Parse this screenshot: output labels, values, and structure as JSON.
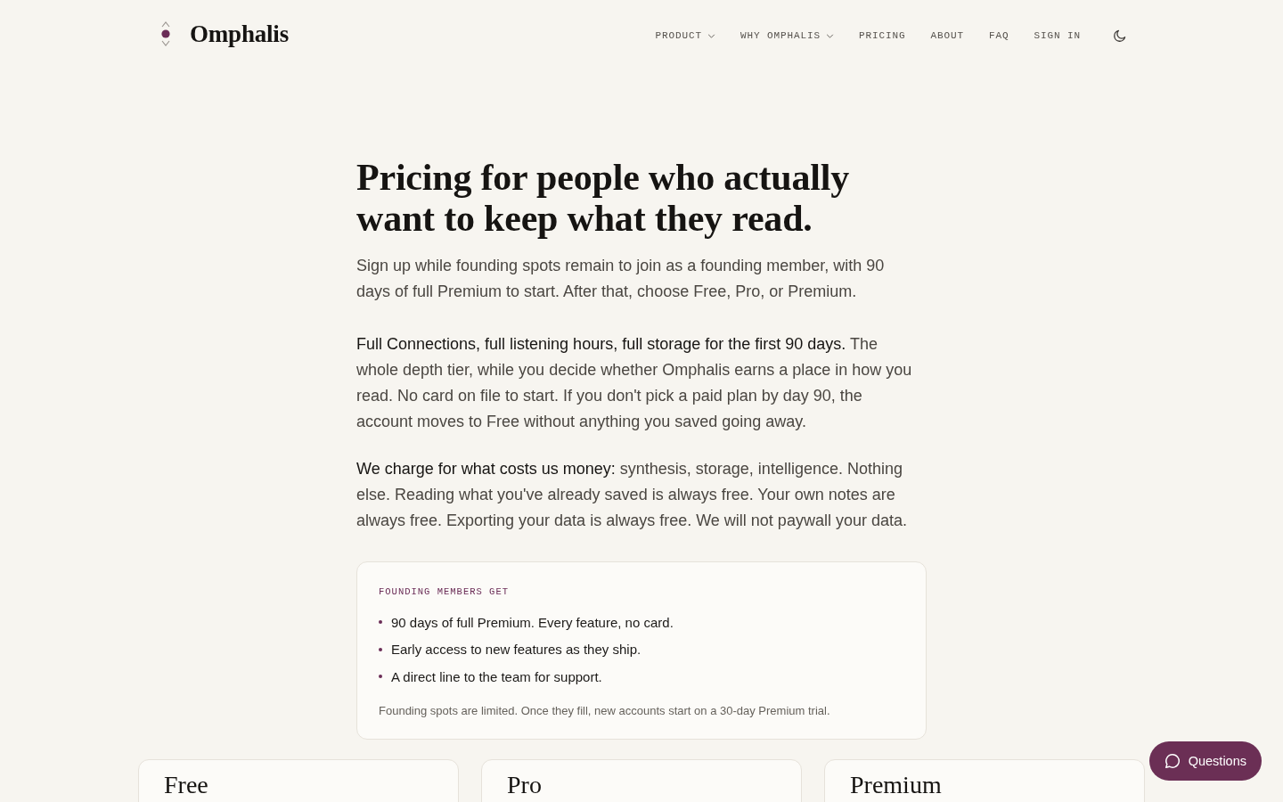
{
  "header": {
    "brand": "Omphalis",
    "nav": [
      {
        "label": "PRODUCT",
        "kind": "dropdown"
      },
      {
        "label": "WHY OMPHALIS",
        "kind": "dropdown"
      },
      {
        "label": "PRICING",
        "kind": "link"
      },
      {
        "label": "ABOUT",
        "kind": "link"
      },
      {
        "label": "FAQ",
        "kind": "link"
      },
      {
        "label": "SIGN IN",
        "kind": "link"
      }
    ]
  },
  "hero": {
    "title": "Pricing for people who actually want to keep what they read.",
    "subtitle": "Sign up while founding spots remain to join as a founding member, with 90 days of full Premium to start. After that, choose Free, Pro, or Premium."
  },
  "paragraphs": [
    {
      "lead": "Full Connections, full listening hours, full storage for the first 90 days.",
      "text": "The whole depth tier, while you decide whether Omphalis earns a place in how you read. No card on file to start. If you don't pick a paid plan by day 90, the account moves to Free without anything you saved going away."
    },
    {
      "lead": "We charge for what costs us money:",
      "text": "synthesis, storage, intelligence. Nothing else. Reading what you've already saved is always free. Your own notes are always free. Exporting your data is always free. We will not paywall your data."
    }
  ],
  "founding_card": {
    "label": "FOUNDING MEMBERS GET",
    "items": [
      "90 days of full Premium. Every feature, no card.",
      "Early access to new features as they ship.",
      "A direct line to the team for support."
    ],
    "note": "Founding spots are limited. Once they fill, new accounts start on a 30-day Premium trial."
  },
  "plans": [
    {
      "name": "Free"
    },
    {
      "name": "Pro"
    },
    {
      "name": "Premium"
    }
  ],
  "chat_button": {
    "label": "Questions"
  }
}
